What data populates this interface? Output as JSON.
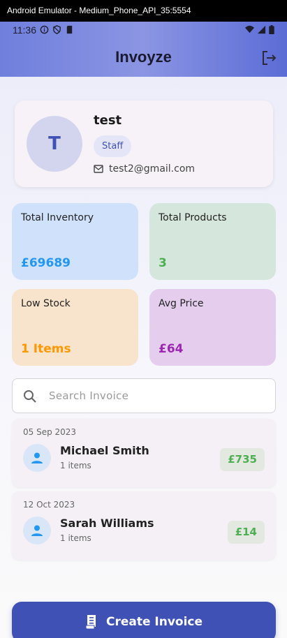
{
  "window_title": "Android Emulator - Medium_Phone_API_35:5554",
  "status": {
    "time": "11:36"
  },
  "app": {
    "title": "Invoyze"
  },
  "profile": {
    "initial": "T",
    "name": "test",
    "role": "Staff",
    "email": "test2@gmail.com"
  },
  "stats": [
    {
      "label": "Total Inventory",
      "value": "£69689",
      "bg": "#cfe1fb",
      "color": "#2196f3"
    },
    {
      "label": "Total Products",
      "value": "3",
      "bg": "#d5e6dc",
      "color": "#4caf50"
    },
    {
      "label": "Low Stock",
      "value": "1 Items",
      "bg": "#f8e3cd",
      "color": "#ff9800"
    },
    {
      "label": "Avg Price",
      "value": "£64",
      "bg": "#e5cdee",
      "color": "#9c27b0"
    }
  ],
  "search": {
    "placeholder": "Search Invoice"
  },
  "invoices": [
    {
      "date": "05 Sep 2023",
      "name": "Michael Smith",
      "items": "1 items",
      "amount": "£735"
    },
    {
      "date": "12 Oct 2023",
      "name": "Sarah Williams",
      "items": "1 items",
      "amount": "£14"
    }
  ],
  "actions": {
    "create_label": "Create Invoice"
  },
  "colors": {
    "primary": "#3f51b5",
    "amount_green": "#4caf50"
  }
}
